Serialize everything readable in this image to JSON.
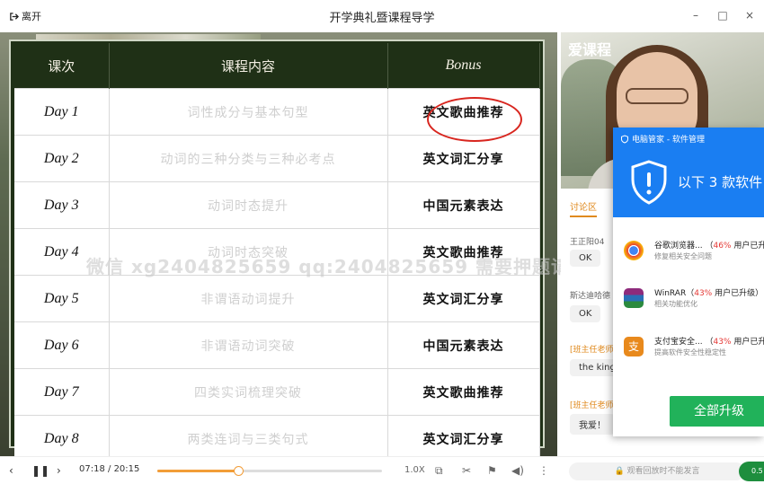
{
  "window": {
    "leave_label": "离开",
    "title": "开学典礼暨课程导学",
    "minimize": "–",
    "maximize": "□",
    "close": "×"
  },
  "table": {
    "headers": {
      "day": "课次",
      "content": "课程内容",
      "bonus": "Bonus"
    },
    "rows": [
      {
        "day": "Day 1",
        "content": "词性成分与基本句型",
        "bonus": "英文歌曲推荐"
      },
      {
        "day": "Day 2",
        "content": "动词的三种分类与三种必考点",
        "bonus": "英文词汇分享"
      },
      {
        "day": "Day 3",
        "content": "动词时态提升",
        "bonus": "中国元素表达"
      },
      {
        "day": "Day 4",
        "content": "动词时态突破",
        "bonus": "英文歌曲推荐"
      },
      {
        "day": "Day 5",
        "content": "非谓语动词提升",
        "bonus": "英文词汇分享"
      },
      {
        "day": "Day 6",
        "content": "非谓语动词突破",
        "bonus": "中国元素表达"
      },
      {
        "day": "Day 7",
        "content": "四类实词梳理突破",
        "bonus": "英文歌曲推荐"
      },
      {
        "day": "Day 8",
        "content": "两类连词与三类句式",
        "bonus": "英文词汇分享"
      }
    ]
  },
  "watermark": "微信 xg2404825659  qq:2404825659  需要押题请加我哦",
  "teacher_cam": {
    "logo": "爱课程"
  },
  "chat": {
    "tab": "讨论区",
    "messages": [
      {
        "user": "王正阳04",
        "text": "OK"
      },
      {
        "user": "斯达迪哈德",
        "text": "OK"
      },
      {
        "user": "[班主任老师]",
        "text": "the king"
      },
      {
        "user": "[班主任老师]",
        "text": "我爱！"
      }
    ]
  },
  "popup": {
    "title": "电脑管家 - 软件管理",
    "headline": "以下 3 款软件",
    "items": [
      {
        "name": "谷歌浏览器...",
        "pct": "46%",
        "tail": "用户已升",
        "sub": "修复相关安全问题",
        "color": "#4285f4"
      },
      {
        "name": "WinRAR",
        "pct": "43%",
        "tail": "用户已升级",
        "sub": "相关功能优化",
        "color": "#8e2b7c"
      },
      {
        "name": "支付宝安全...",
        "pct": "43%",
        "tail": "用户已升",
        "sub": "提高软件安全性稳定性",
        "color": "#e8891c"
      }
    ],
    "upgrade_button": "全部升级"
  },
  "player": {
    "current_time": "07:18",
    "total_time": "20:15",
    "progress": 0.36,
    "speed": "1.0X",
    "replay_note": "观看回放时不能发言",
    "badge": "0.5"
  }
}
